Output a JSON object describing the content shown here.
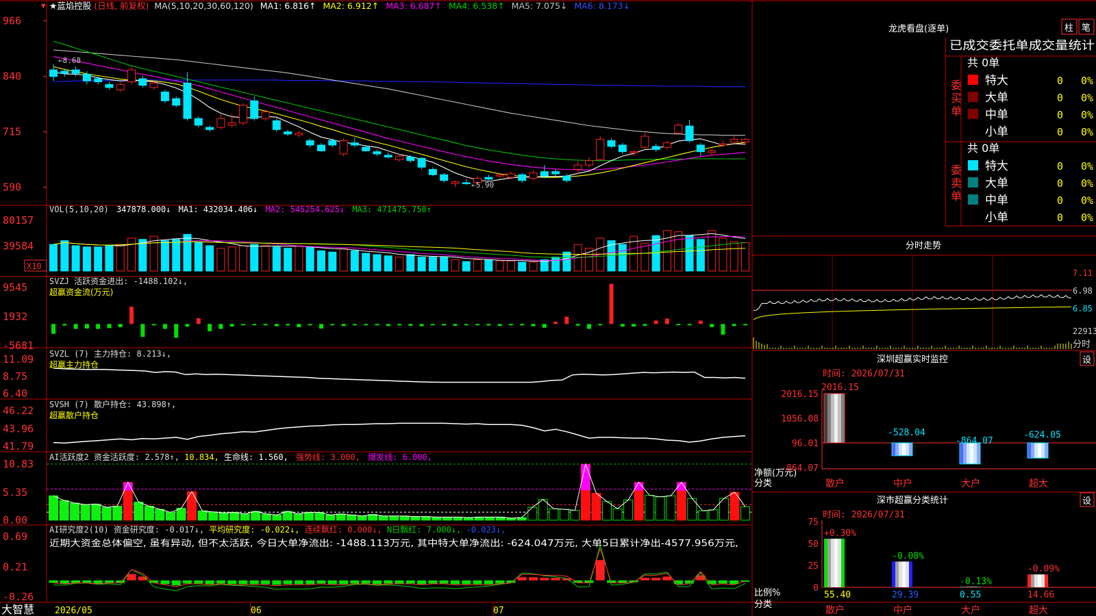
{
  "colors": {
    "up": "#ff2020",
    "down": "#00e5ff",
    "grid": "#c00000",
    "axis": "#ff3030",
    "ma1": "#ffffff",
    "ma2": "#ffff00",
    "ma3": "#ff00ff",
    "ma4": "#00c000",
    "ma5": "#c0c0c0",
    "ma6": "#2020ff"
  },
  "icons": {
    "star": "★",
    "menu": "▼"
  },
  "header": {
    "name": "★蓝焰控股",
    "period": "(日线, 前复权)",
    "ma_def": "MA(5,10,20,30,60,120)",
    "ma1": "MA1: 6.816↑",
    "ma2": "MA2: 6.912↑",
    "ma3": "MA3: 6.687↑",
    "ma4": "MA4: 6.538↑",
    "ma5": "MA5: 7.075↓",
    "ma6": "MA6: 8.173↓"
  },
  "price_panel": {
    "yticks": [
      "966",
      "840",
      "715",
      "590"
    ],
    "high_note": "←8.68",
    "low_note": "←5.90"
  },
  "vol_panel": {
    "title": "VOL(5,10,20)",
    "v": "347878.000↓",
    "ma1": "MA1: 432034.406↓",
    "ma2": "MA2: 545254.625↓",
    "ma3": "MA3: 471475.750↑",
    "yticks": [
      "80157",
      "39584"
    ],
    "unit": "X10"
  },
  "svzj_panel": {
    "line1": "SVZJ  活跃资金进出: -1488.102↓,",
    "line2": "超赢资金流(万元)",
    "yticks": [
      "9545",
      "1932",
      "-5681"
    ]
  },
  "svzl_panel": {
    "line1": "SVZL (7) 主力持仓: 8.213↓,",
    "line2": "超赢主力持仓",
    "yticks": [
      "11.09",
      "8.75",
      "6.40"
    ]
  },
  "svsh_panel": {
    "line1": "SVSH (7) 散户持仓: 43.898↑,",
    "line2": "超赢散户持仓",
    "yticks": [
      "46.22",
      "43.96",
      "41.79"
    ]
  },
  "ai1_panel": {
    "a": "AI活跃度2 资金活跃度: 2.578↑,",
    "b": "10.834,",
    "c": "生命线: 1.560,",
    "d": "强势线: 3.000,",
    "e": "爆发线: 6.000,",
    "yticks": [
      "10.83",
      "5.35",
      "0.00"
    ]
  },
  "ai2_panel": {
    "a": "AI研究度2(10) 资金研究度: -0.017↓,",
    "b": "平均研究度: -0.022↓,",
    "c": "连续飘红: 0.000↓,",
    "d": "N日飘红: 7.000↓,",
    "e": "-0.023↓,",
    "comment": "近期大资金总体偏空, 虽有异动, 但不太活跃, 今日大单净流出: -1488.113万元, 其中特大单净流出: -624.047万元, 大单5日累计净出-4577.956万元,",
    "yticks": [
      "0.69",
      "0.21",
      "-0.26"
    ]
  },
  "bottom_bar": {
    "brand": "大智慧",
    "d1": "2026/05",
    "d2": "06",
    "d3": "07"
  },
  "right": {
    "lhkp_title": "龙虎看盘(逐单)",
    "btn_zhu": "柱",
    "btn_bi": "笔",
    "tab_header": "已成交委托单成交量统计",
    "buy_label": "委买单",
    "sell_label": "委卖单",
    "buy_total": "共 0单",
    "sell_total": "共 0单",
    "rows_buy": [
      {
        "name": "特大",
        "n": "0",
        "p": "0%"
      },
      {
        "name": "大单",
        "n": "0",
        "p": "0%"
      },
      {
        "name": "中单",
        "n": "0",
        "p": "0%"
      },
      {
        "name": "小单",
        "n": "0",
        "p": "0%"
      }
    ],
    "rows_sell": [
      {
        "name": "特大",
        "n": "0",
        "p": "0%"
      },
      {
        "name": "大单",
        "n": "0",
        "p": "0%"
      },
      {
        "name": "中单",
        "n": "0",
        "p": "0%"
      },
      {
        "name": "小单",
        "n": "0",
        "p": "0%"
      }
    ],
    "fs_title": "分时走势",
    "fs_y1": "7.11",
    "fs_y2": "6.98",
    "fs_y3": "6.85",
    "fs_v": "22913",
    "fs_lbl": "分时",
    "sz_title": "深圳超赢实时监控",
    "sz_btn": "设",
    "sz_time": "时间: 2026/07/31",
    "sz_yticks": [
      "2016.15",
      "1056.08",
      "96.01",
      "-864.07"
    ],
    "sz_vals": [
      "2016.15",
      "-528.04",
      "-864.07",
      "-624.05"
    ],
    "sz_ylabel1": "净额(万元)",
    "sz_ylabel2": "分类",
    "sz_cats": [
      "散户",
      "中户",
      "大户",
      "超大"
    ],
    "ss_title": "深市超赢分类统计",
    "ss_btn": "设",
    "ss_time": "时间: 2026/07/31",
    "ss_yticks": [
      "75",
      "50",
      "25",
      "0"
    ],
    "ss_pcts": [
      "+0.30%",
      "-0.08%",
      "-0.13%",
      "-0.09%"
    ],
    "ss_vals": [
      "55.40",
      "29.39",
      "0.55",
      "14.66"
    ],
    "ss_ylabel1": "比例%",
    "ss_ylabel2": "分类",
    "ss_cats": [
      "散户",
      "中户",
      "大户",
      "超大"
    ]
  },
  "chart_data": {
    "type": "candlestick",
    "candles": [
      {
        "o": 8.55,
        "c": 8.4,
        "h": 8.68,
        "l": 8.3
      },
      {
        "o": 8.52,
        "c": 8.47,
        "h": 8.58,
        "l": 8.4
      },
      {
        "o": 8.55,
        "c": 8.47,
        "h": 8.62,
        "l": 8.4
      },
      {
        "o": 8.45,
        "c": 8.3,
        "h": 8.52,
        "l": 8.22
      },
      {
        "o": 8.35,
        "c": 8.28,
        "h": 8.4,
        "l": 8.22
      },
      {
        "o": 8.22,
        "c": 8.15,
        "h": 8.28,
        "l": 8.1
      },
      {
        "o": 8.1,
        "c": 8.22,
        "h": 8.28,
        "l": 8.05
      },
      {
        "o": 8.28,
        "c": 8.55,
        "h": 8.62,
        "l": 8.22
      },
      {
        "o": 8.35,
        "c": 8.2,
        "h": 8.42,
        "l": 8.15
      },
      {
        "o": 8.15,
        "c": 8.25,
        "h": 8.32,
        "l": 8.1
      },
      {
        "o": 8.05,
        "c": 7.85,
        "h": 8.1,
        "l": 7.8
      },
      {
        "o": 7.9,
        "c": 7.75,
        "h": 7.95,
        "l": 7.7
      },
      {
        "o": 8.25,
        "c": 7.45,
        "h": 8.5,
        "l": 7.4
      },
      {
        "o": 7.45,
        "c": 7.3,
        "h": 7.5,
        "l": 7.25
      },
      {
        "o": 7.25,
        "c": 7.2,
        "h": 7.3,
        "l": 7.15
      },
      {
        "o": 7.25,
        "c": 7.45,
        "h": 7.55,
        "l": 7.2
      },
      {
        "o": 7.3,
        "c": 7.35,
        "h": 7.55,
        "l": 7.25
      },
      {
        "o": 7.35,
        "c": 7.75,
        "h": 7.8,
        "l": 7.3
      },
      {
        "o": 7.85,
        "c": 7.45,
        "h": 7.95,
        "l": 7.4
      },
      {
        "o": 7.45,
        "c": 7.6,
        "h": 7.65,
        "l": 7.4
      },
      {
        "o": 7.4,
        "c": 7.2,
        "h": 7.45,
        "l": 7.15
      },
      {
        "o": 7.15,
        "c": 7.1,
        "h": 7.2,
        "l": 7.05
      },
      {
        "o": 7.08,
        "c": 7.12,
        "h": 7.18,
        "l": 7.02
      },
      {
        "o": 6.95,
        "c": 6.85,
        "h": 7.0,
        "l": 6.8
      },
      {
        "o": 6.85,
        "c": 6.72,
        "h": 6.9,
        "l": 6.7
      },
      {
        "o": 6.95,
        "c": 6.85,
        "h": 7.0,
        "l": 6.8
      },
      {
        "o": 6.65,
        "c": 6.95,
        "h": 7.0,
        "l": 6.6
      },
      {
        "o": 6.9,
        "c": 6.85,
        "h": 7.02,
        "l": 6.8
      },
      {
        "o": 6.8,
        "c": 6.72,
        "h": 6.85,
        "l": 6.7
      },
      {
        "o": 6.7,
        "c": 6.65,
        "h": 6.75,
        "l": 6.6
      },
      {
        "o": 6.62,
        "c": 6.58,
        "h": 6.68,
        "l": 6.55
      },
      {
        "o": 6.52,
        "c": 6.6,
        "h": 6.65,
        "l": 6.48
      },
      {
        "o": 6.58,
        "c": 6.5,
        "h": 6.62,
        "l": 6.45
      },
      {
        "o": 6.55,
        "c": 6.35,
        "h": 6.58,
        "l": 6.3
      },
      {
        "o": 6.3,
        "c": 6.18,
        "h": 6.35,
        "l": 6.15
      },
      {
        "o": 6.18,
        "c": 6.05,
        "h": 6.22,
        "l": 6.0
      },
      {
        "o": 5.98,
        "c": 6.02,
        "h": 6.05,
        "l": 5.9
      },
      {
        "o": 6.0,
        "c": 5.98,
        "h": 6.08,
        "l": 5.95
      },
      {
        "o": 6.0,
        "c": 6.1,
        "h": 6.15,
        "l": 5.95
      },
      {
        "o": 6.12,
        "c": 6.08,
        "h": 6.18,
        "l": 6.05
      },
      {
        "o": 6.15,
        "c": 6.18,
        "h": 6.22,
        "l": 6.1
      },
      {
        "o": 6.12,
        "c": 6.2,
        "h": 6.25,
        "l": 6.08
      },
      {
        "o": 6.18,
        "c": 6.05,
        "h": 6.22,
        "l": 6.0
      },
      {
        "o": 6.1,
        "c": 6.22,
        "h": 6.28,
        "l": 6.05
      },
      {
        "o": 6.25,
        "c": 6.15,
        "h": 6.4,
        "l": 6.1
      },
      {
        "o": 6.25,
        "c": 6.2,
        "h": 6.3,
        "l": 6.15
      },
      {
        "o": 6.15,
        "c": 6.05,
        "h": 6.2,
        "l": 6.0
      },
      {
        "o": 6.3,
        "c": 6.4,
        "h": 6.48,
        "l": 6.2
      },
      {
        "o": 6.4,
        "c": 6.5,
        "h": 6.58,
        "l": 6.35
      },
      {
        "o": 6.52,
        "c": 6.98,
        "h": 7.05,
        "l": 6.5
      },
      {
        "o": 6.95,
        "c": 6.82,
        "h": 7.0,
        "l": 6.78
      },
      {
        "o": 6.85,
        "c": 6.7,
        "h": 6.9,
        "l": 6.65
      },
      {
        "o": 6.68,
        "c": 6.7,
        "h": 6.75,
        "l": 6.6
      },
      {
        "o": 6.8,
        "c": 7.05,
        "h": 7.12,
        "l": 6.78
      },
      {
        "o": 6.82,
        "c": 6.75,
        "h": 6.88,
        "l": 6.7
      },
      {
        "o": 6.8,
        "c": 6.9,
        "h": 6.95,
        "l": 6.75
      },
      {
        "o": 7.12,
        "c": 7.3,
        "h": 7.35,
        "l": 7.1
      },
      {
        "o": 7.28,
        "c": 6.95,
        "h": 7.42,
        "l": 6.9
      },
      {
        "o": 6.85,
        "c": 6.7,
        "h": 6.9,
        "l": 6.6
      },
      {
        "o": 6.68,
        "c": 6.72,
        "h": 6.78,
        "l": 6.62
      },
      {
        "o": 6.85,
        "c": 6.88,
        "h": 6.95,
        "l": 6.8
      },
      {
        "o": 6.92,
        "c": 6.98,
        "h": 7.05,
        "l": 6.88
      },
      {
        "o": 6.92,
        "c": 6.98,
        "h": 7.02,
        "l": 6.85
      }
    ],
    "volume": [
      42,
      48,
      40,
      38,
      38,
      40,
      42,
      52,
      50,
      55,
      48,
      50,
      58,
      45,
      40,
      36,
      38,
      40,
      42,
      40,
      38,
      36,
      40,
      38,
      32,
      30,
      35,
      32,
      28,
      26,
      24,
      22,
      26,
      22,
      22,
      22,
      18,
      15,
      18,
      18,
      16,
      16,
      14,
      14,
      18,
      22,
      30,
      42,
      36,
      52,
      48,
      42,
      55,
      44,
      56,
      64,
      62,
      56,
      50,
      64,
      52,
      46,
      45
    ],
    "ma_price": {
      "ma1": [
        8.5,
        8.46,
        8.45,
        8.43,
        8.37,
        8.33,
        8.3,
        8.31,
        8.3,
        8.28,
        8.22,
        8.14,
        8.03,
        7.88,
        7.7,
        7.57,
        7.49,
        7.47,
        7.47,
        7.5,
        7.48,
        7.37,
        7.26,
        7.14,
        7.03,
        6.97,
        6.91,
        6.88,
        6.83,
        6.8,
        6.72,
        6.64,
        6.59,
        6.53,
        6.46,
        6.34,
        6.22,
        6.13,
        6.06,
        6.03,
        6.07,
        6.11,
        6.12,
        6.13,
        6.14,
        6.14,
        6.15,
        6.21,
        6.26,
        6.38,
        6.5,
        6.6,
        6.66,
        6.75,
        6.76,
        6.85,
        6.94,
        6.97,
        6.99,
        6.92,
        6.85,
        6.88,
        6.87
      ],
      "ma2": [
        8.62,
        8.56,
        8.51,
        8.46,
        8.42,
        8.38,
        8.34,
        8.32,
        8.31,
        8.3,
        8.27,
        8.23,
        8.16,
        8.07,
        7.97,
        7.88,
        7.8,
        7.73,
        7.67,
        7.62,
        7.56,
        7.49,
        7.42,
        7.35,
        7.27,
        7.2,
        7.12,
        7.05,
        6.98,
        6.91,
        6.85,
        6.78,
        6.71,
        6.64,
        6.57,
        6.5,
        6.43,
        6.36,
        6.3,
        6.25,
        6.2,
        6.17,
        6.14,
        6.13,
        6.12,
        6.12,
        6.13,
        6.15,
        6.18,
        6.22,
        6.27,
        6.33,
        6.39,
        6.45,
        6.51,
        6.57,
        6.63,
        6.69,
        6.74,
        6.8,
        6.84,
        6.88,
        6.91
      ],
      "ma3": [
        8.85,
        8.8,
        8.75,
        8.7,
        8.65,
        8.6,
        8.55,
        8.5,
        8.45,
        8.4,
        8.35,
        8.3,
        8.25,
        8.19,
        8.12,
        8.05,
        7.98,
        7.91,
        7.84,
        7.77,
        7.7,
        7.63,
        7.56,
        7.49,
        7.42,
        7.35,
        7.28,
        7.21,
        7.14,
        7.07,
        7.0,
        6.94,
        6.88,
        6.82,
        6.76,
        6.7,
        6.64,
        6.59,
        6.54,
        6.49,
        6.45,
        6.41,
        6.38,
        6.35,
        6.33,
        6.31,
        6.3,
        6.29,
        6.29,
        6.3,
        6.32,
        6.34,
        6.37,
        6.4,
        6.43,
        6.47,
        6.51,
        6.55,
        6.59,
        6.62,
        6.64,
        6.66,
        6.69
      ],
      "ma4": [
        9.2,
        9.12,
        9.04,
        8.96,
        8.88,
        8.8,
        8.72,
        8.64,
        8.58,
        8.52,
        8.46,
        8.4,
        8.34,
        8.28,
        8.22,
        8.16,
        8.1,
        8.04,
        7.98,
        7.92,
        7.86,
        7.8,
        7.74,
        7.68,
        7.62,
        7.56,
        7.5,
        7.44,
        7.38,
        7.32,
        7.26,
        7.2,
        7.14,
        7.08,
        7.02,
        6.96,
        6.9,
        6.84,
        6.79,
        6.74,
        6.7,
        6.66,
        6.62,
        6.59,
        6.56,
        6.54,
        6.52,
        6.51,
        6.5,
        6.5,
        6.5,
        6.51,
        6.52,
        6.52,
        6.53,
        6.53,
        6.53,
        6.54,
        6.54,
        6.54,
        6.54,
        6.54,
        6.54
      ],
      "ma5": [
        9.0,
        8.98,
        8.96,
        8.94,
        8.92,
        8.9,
        8.88,
        8.86,
        8.84,
        8.82,
        8.8,
        8.78,
        8.75,
        8.72,
        8.69,
        8.66,
        8.63,
        8.6,
        8.57,
        8.54,
        8.51,
        8.48,
        8.44,
        8.4,
        8.36,
        8.32,
        8.28,
        8.24,
        8.2,
        8.16,
        8.12,
        8.07,
        8.02,
        7.97,
        7.92,
        7.87,
        7.82,
        7.77,
        7.72,
        7.67,
        7.62,
        7.57,
        7.53,
        7.49,
        7.45,
        7.41,
        7.37,
        7.33,
        7.29,
        7.26,
        7.23,
        7.2,
        7.17,
        7.15,
        7.13,
        7.11,
        7.1,
        7.09,
        7.08,
        7.08,
        7.07,
        7.07,
        7.07
      ],
      "ma6": [
        8.28,
        8.29,
        8.3,
        8.3,
        8.31,
        8.31,
        8.31,
        8.31,
        8.32,
        8.32,
        8.32,
        8.32,
        8.32,
        8.32,
        8.32,
        8.32,
        8.32,
        8.32,
        8.32,
        8.32,
        8.32,
        8.31,
        8.31,
        8.31,
        8.31,
        8.3,
        8.3,
        8.3,
        8.3,
        8.29,
        8.29,
        8.29,
        8.28,
        8.28,
        8.28,
        8.27,
        8.27,
        8.26,
        8.26,
        8.25,
        8.25,
        8.24,
        8.24,
        8.23,
        8.23,
        8.22,
        8.22,
        8.21,
        8.21,
        8.2,
        8.2,
        8.2,
        8.19,
        8.19,
        8.19,
        8.18,
        8.18,
        8.18,
        8.18,
        8.17,
        8.17,
        8.17,
        8.17
      ]
    },
    "svzj": [
      -2600,
      -420,
      -1300,
      -1200,
      -1300,
      -1100,
      -850,
      4500,
      -3400,
      -200,
      -1300,
      -3600,
      -700,
      1500,
      -1900,
      -1300,
      -700,
      -200,
      -200,
      -200,
      -600,
      -100,
      -850,
      -100,
      -1200,
      -200,
      -550,
      -300,
      -200,
      -300,
      -550,
      -300,
      -500,
      -600,
      -250,
      -400,
      -500,
      -250,
      -350,
      -400,
      -550,
      -200,
      -400,
      -600,
      -1000,
      600,
      1900,
      -450,
      -1300,
      -200,
      10500,
      -700,
      -700,
      -500,
      900,
      1400,
      -250,
      -250,
      850,
      -850,
      -2800,
      -550,
      -150
    ],
    "svzl": [
      9.9,
      9.8,
      9.75,
      9.7,
      9.7,
      9.7,
      9.65,
      9.6,
      9.55,
      9.5,
      9.3,
      9.4,
      9.35,
      9.0,
      9.1,
      9.0,
      9.05,
      9.0,
      8.95,
      8.9,
      8.85,
      8.8,
      8.75,
      8.7,
      8.65,
      8.6,
      8.5,
      8.45,
      8.4,
      8.35,
      8.3,
      8.25,
      8.2,
      8.15,
      8.1,
      8.05,
      8.0,
      7.98,
      7.95,
      7.95,
      7.95,
      7.95,
      7.95,
      7.95,
      7.95,
      7.95,
      7.95,
      7.95,
      8.05,
      8.2,
      8.25,
      8.95,
      9.05,
      9.0,
      8.95,
      9.0,
      9.1,
      9.2,
      9.3,
      9.25,
      9.3,
      9.35,
      9.3,
      9.35,
      8.6,
      8.6,
      8.55,
      8.6,
      8.5
    ],
    "svsh": [
      42.25,
      42.2,
      42.3,
      42.4,
      42.5,
      42.6,
      42.7,
      42.6,
      42.75,
      42.7,
      42.8,
      42.9,
      42.65,
      43.0,
      43.15,
      43.35,
      43.45,
      43.6,
      43.55,
      43.75,
      43.95,
      44.1,
      44.2,
      44.3,
      44.35,
      44.45,
      44.5,
      44.5,
      44.55,
      44.6,
      44.6,
      44.65,
      44.65,
      44.65,
      44.65,
      44.65,
      44.6,
      44.55,
      44.6,
      44.5,
      44.5,
      44.5,
      44.4,
      44.1,
      43.7,
      43.9,
      43.6,
      43.2,
      42.8,
      42.9,
      42.9,
      42.85,
      42.8,
      42.8,
      42.7,
      42.55,
      42.5,
      42.3,
      42.45,
      42.7,
      42.9,
      43.0,
      43.1
    ],
    "ai1": [
      4.7,
      3.8,
      3.3,
      3.0,
      3.1,
      2.5,
      2.7,
      7.3,
      3.5,
      2.7,
      2.1,
      1.5,
      2.3,
      5.5,
      1.8,
      1.6,
      1.4,
      1.5,
      1.2,
      1.7,
      1.2,
      1.0,
      1.7,
      1.2,
      1.5,
      1.5,
      1.0,
      1.2,
      1.0,
      0.8,
      1.1,
      0.8,
      0.8,
      0.8,
      0.7,
      0.7,
      0.6,
      0.6,
      0.6,
      0.5,
      0.6,
      0.6,
      0.6,
      0.4,
      0.5,
      2.5,
      4.0,
      2.2,
      2.1,
      1.9,
      10.8,
      5.2,
      3.6,
      2.2,
      3.9,
      7.3,
      4.8,
      4.5,
      4.7,
      7.3,
      4.2,
      1.8,
      2.0,
      4.2,
      5.4,
      2.6
    ],
    "ai2": [
      -0.04,
      -0.05,
      -0.04,
      -0.04,
      -0.05,
      -0.04,
      -0.04,
      0.1,
      0.06,
      -0.04,
      -0.06,
      -0.08,
      -0.05,
      -0.05,
      -0.06,
      -0.05,
      -0.06,
      -0.06,
      -0.06,
      -0.06,
      -0.07,
      -0.06,
      -0.06,
      -0.06,
      -0.05,
      -0.06,
      -0.06,
      -0.05,
      -0.05,
      -0.06,
      -0.05,
      -0.05,
      -0.05,
      -0.06,
      -0.05,
      -0.05,
      -0.06,
      -0.06,
      -0.06,
      -0.06,
      -0.05,
      -0.04,
      0.05,
      0.05,
      0.04,
      0.04,
      0.03,
      -0.04,
      -0.04,
      0.32,
      -0.04,
      -0.04,
      -0.03,
      0.04,
      0.04,
      0.06,
      -0.06,
      -0.05,
      0.08,
      -0.06,
      -0.05,
      -0.06,
      -0.02
    ]
  }
}
